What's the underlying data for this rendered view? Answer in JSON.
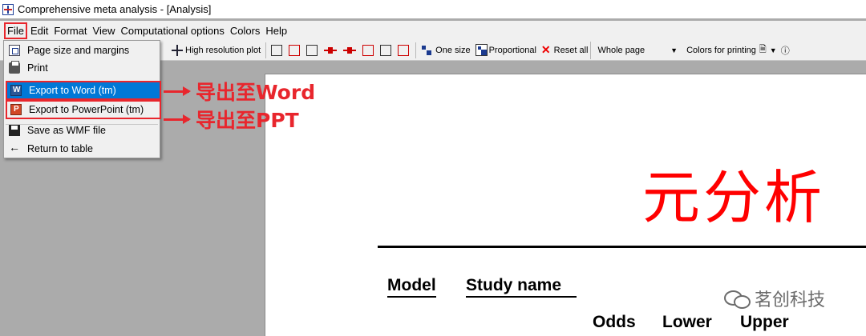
{
  "window": {
    "title": "Comprehensive meta analysis - [Analysis]"
  },
  "menubar": [
    "File",
    "Edit",
    "Format",
    "View",
    "Computational options",
    "Colors",
    "Help"
  ],
  "toolbar": {
    "high_res": "High resolution plot",
    "one_size": "One size",
    "proportional": "Proportional",
    "reset_all": "Reset all",
    "whole_page": "Whole page",
    "colors_printing": "Colors for printing"
  },
  "file_menu": {
    "page_size": "Page size and margins",
    "print": "Print",
    "export_word": "Export to Word (tm)",
    "export_ppt": "Export to PowerPoint (tm)",
    "save_wmf": "Save as WMF file",
    "return_table": "Return to table"
  },
  "annotations": {
    "word": "导出至Word",
    "ppt": "导出至PPT"
  },
  "page": {
    "title": "元分析",
    "headers": {
      "model": "Model",
      "study_name": "Study name",
      "odds": "Odds",
      "lower": "Lower",
      "upper": "Upper"
    }
  },
  "watermark": "茗创科技",
  "colors": {
    "annotation_red": "#e8262d",
    "title_red": "#ff0000",
    "highlight_blue": "#0078d7"
  }
}
